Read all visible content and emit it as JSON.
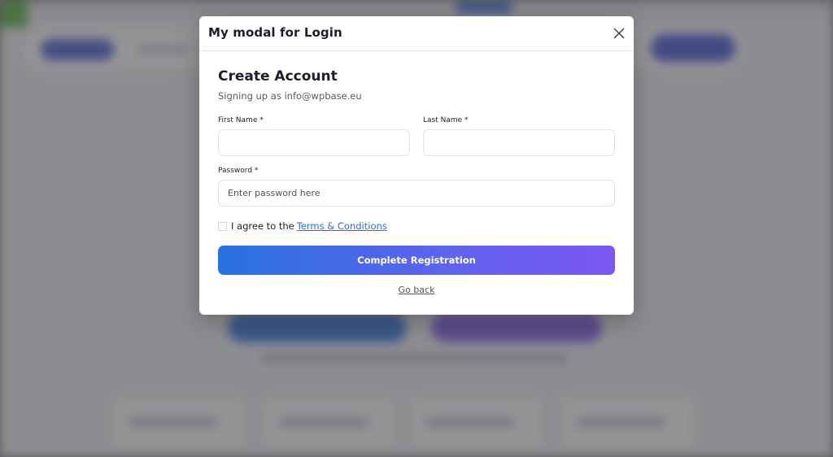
{
  "modal": {
    "title": "My modal for Login",
    "close_icon": "close-icon"
  },
  "form": {
    "heading": "Create Account",
    "subtitle": "Signing up as info@wpbase.eu",
    "first_name": {
      "label": "First Name *",
      "value": "",
      "placeholder": ""
    },
    "last_name": {
      "label": "Last Name *",
      "value": "",
      "placeholder": ""
    },
    "password": {
      "label": "Password *",
      "value": "",
      "placeholder": "Enter password here"
    },
    "agree_text": "I agree to the",
    "terms_link": "Terms & Conditions",
    "submit_label": "Complete Registration",
    "go_back_label": "Go back"
  },
  "colors": {
    "gradient_start": "#2872e3",
    "gradient_end": "#7b56f3",
    "link": "#2f6fd6"
  }
}
